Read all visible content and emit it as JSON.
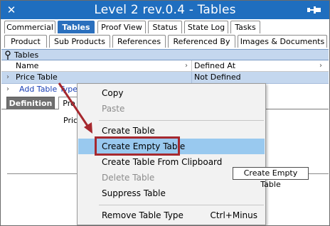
{
  "window": {
    "title": "Level 2 rev.0.4 - Tables",
    "colors": {
      "titlebar": "#1f6ebf",
      "selection": "#c4d7ee",
      "hover": "#99c9ef",
      "annotation": "#a6282e"
    }
  },
  "tabs_row1": [
    "Commercial",
    "Tables",
    "Proof View",
    "Status",
    "State Log",
    "Tasks"
  ],
  "tabs_row2": [
    "Product",
    "Sub Products",
    "References",
    "Referenced By",
    "Images & Documents"
  ],
  "tables_panel": {
    "header": "Tables",
    "columns": [
      "Name",
      "Defined At"
    ],
    "selected_row": {
      "name": "Price Table",
      "defined_at": "Not Defined"
    },
    "add_link": "Add Table Type"
  },
  "sub_tabs": [
    "Definition",
    "Pro"
  ],
  "content": {
    "label": "Price"
  },
  "context_menu": {
    "items": [
      {
        "label": "Copy",
        "disabled": false,
        "shortcut": ""
      },
      {
        "label": "Paste",
        "disabled": true,
        "shortcut": ""
      },
      {
        "label": "Create Table",
        "disabled": false,
        "shortcut": ""
      },
      {
        "label": "Create Empty Table",
        "disabled": false,
        "shortcut": "",
        "hover": true
      },
      {
        "label": "Create Table From Clipboard",
        "disabled": false,
        "shortcut": ""
      },
      {
        "label": "Delete Table",
        "disabled": true,
        "shortcut": ""
      },
      {
        "label": "Suppress Table",
        "disabled": false,
        "shortcut": ""
      },
      {
        "label": "Remove Table Type",
        "disabled": false,
        "shortcut": "Ctrl+Minus"
      }
    ]
  },
  "tooltip": "Create Empty Table",
  "icons": {
    "close": "close-icon",
    "pin": "pin-icon",
    "tables_pin": "pushpin-icon",
    "expander": "chevron-right-icon",
    "sort": "chevron-right-icon"
  }
}
